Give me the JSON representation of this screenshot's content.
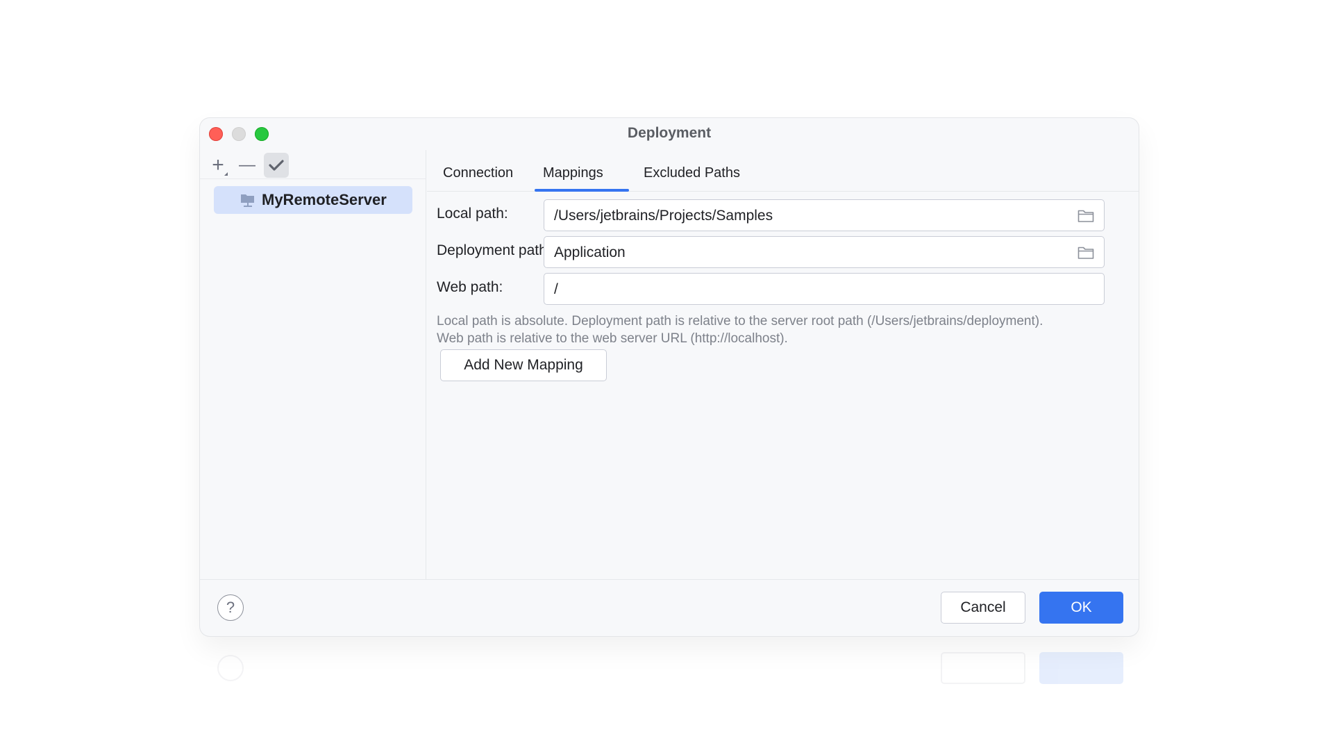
{
  "window": {
    "title": "Deployment"
  },
  "sidebar": {
    "toolbar": {
      "add_label": "+",
      "remove_label": "—",
      "check_label": "✔"
    },
    "servers": [
      {
        "label": "MyRemoteServer",
        "icon": "server-icon",
        "selected": true
      }
    ]
  },
  "tabs": [
    {
      "label": "Connection",
      "active": false
    },
    {
      "label": "Mappings",
      "active": true
    },
    {
      "label": "Excluded Paths",
      "active": false
    }
  ],
  "mappings": {
    "local_path": {
      "label": "Local path:",
      "value": "/Users/jetbrains/Projects/Samples"
    },
    "deployment_path": {
      "label": "Deployment path:",
      "value": "Application"
    },
    "web_path": {
      "label": "Web path:",
      "value": "/"
    },
    "hint_line1": "Local path is absolute. Deployment path is relative to the server root path (/Users/jetbrains/deployment).",
    "hint_line2": "Web path is relative to the web server URL (http://localhost).",
    "add_mapping_label": "Add New Mapping"
  },
  "footer": {
    "help_label": "?",
    "cancel_label": "Cancel",
    "ok_label": "OK"
  },
  "colors": {
    "accent": "#3574f0",
    "selection": "#d5e1fb",
    "close": "#ff5f57",
    "maximize": "#28c840"
  }
}
